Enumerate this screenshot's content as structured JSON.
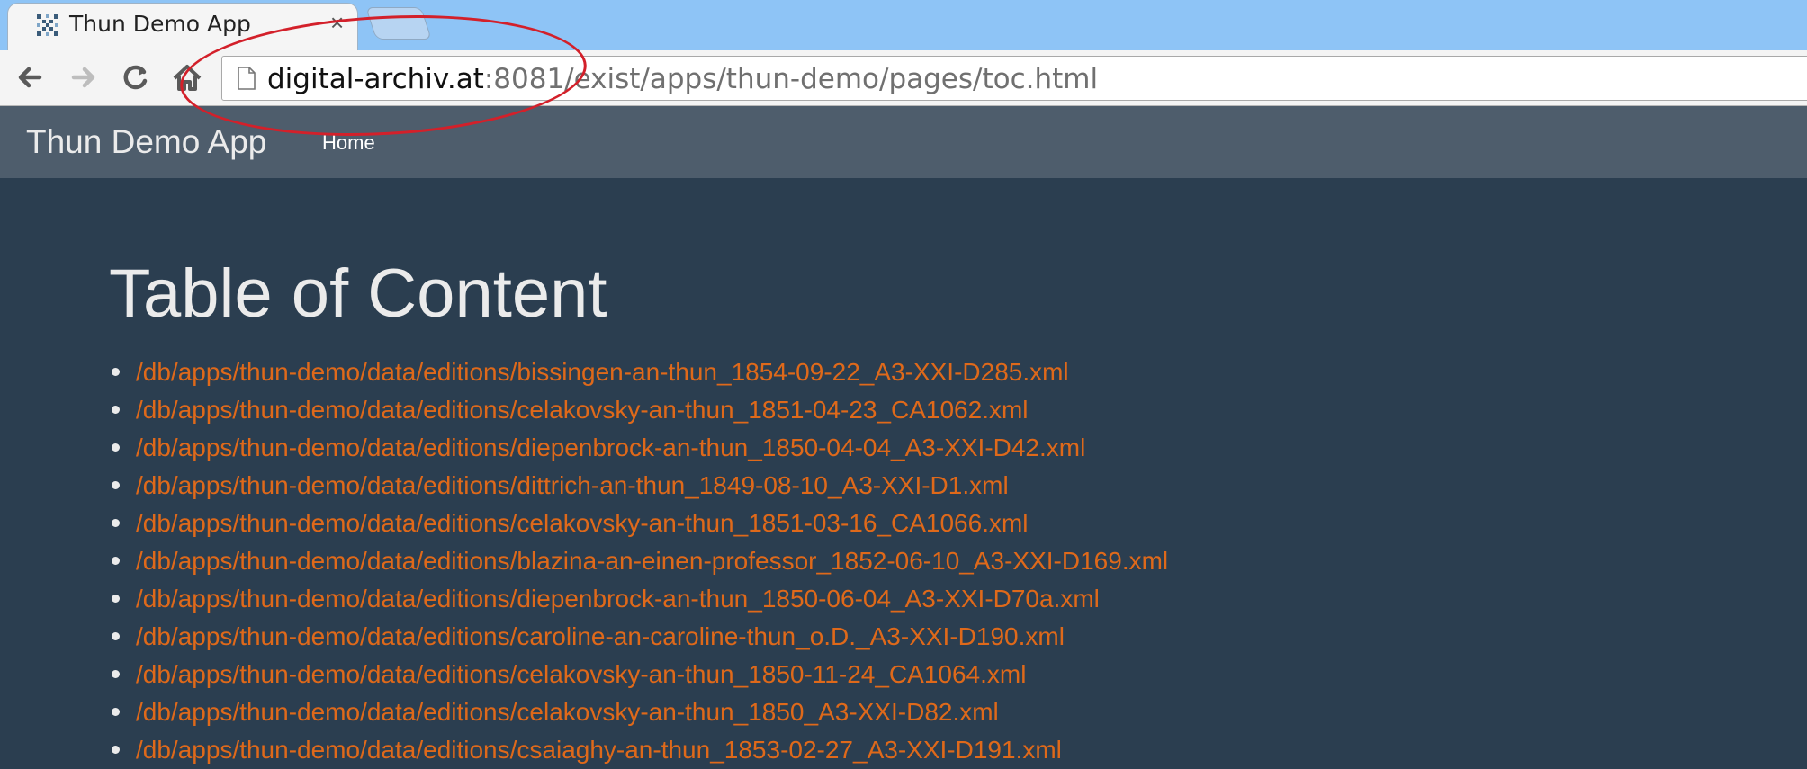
{
  "browser": {
    "tab": {
      "title": "Thun Demo App",
      "close_glyph": "×",
      "favicon": "app-favicon-icon"
    },
    "url": {
      "host": "digital-archiv.at",
      "rest": ":8081/exist/apps/thun-demo/pages/toc.html"
    },
    "icons": {
      "back": "back-arrow-icon",
      "forward": "forward-arrow-icon",
      "reload": "reload-icon",
      "home": "home-icon",
      "page": "page-icon"
    },
    "colors": {
      "tabstrip": "#8ec4f6",
      "annotation": "#d3202a"
    }
  },
  "app": {
    "brand": "Thun Demo App",
    "nav": {
      "home": "Home"
    },
    "colors": {
      "background": "#2b3e50",
      "navbar": "#4e5d6c",
      "link": "#df691a",
      "text": "#ebebeb"
    }
  },
  "content": {
    "heading": "Table of Content",
    "items": [
      "/db/apps/thun-demo/data/editions/bissingen-an-thun_1854-09-22_A3-XXI-D285.xml",
      "/db/apps/thun-demo/data/editions/celakovsky-an-thun_1851-04-23_CA1062.xml",
      "/db/apps/thun-demo/data/editions/diepenbrock-an-thun_1850-04-04_A3-XXI-D42.xml",
      "/db/apps/thun-demo/data/editions/dittrich-an-thun_1849-08-10_A3-XXI-D1.xml",
      "/db/apps/thun-demo/data/editions/celakovsky-an-thun_1851-03-16_CA1066.xml",
      "/db/apps/thun-demo/data/editions/blazina-an-einen-professor_1852-06-10_A3-XXI-D169.xml",
      "/db/apps/thun-demo/data/editions/diepenbrock-an-thun_1850-06-04_A3-XXI-D70a.xml",
      "/db/apps/thun-demo/data/editions/caroline-an-caroline-thun_o.D._A3-XXI-D190.xml",
      "/db/apps/thun-demo/data/editions/celakovsky-an-thun_1850-11-24_CA1064.xml",
      "/db/apps/thun-demo/data/editions/celakovsky-an-thun_1850_A3-XXI-D82.xml",
      "/db/apps/thun-demo/data/editions/csaiaghy-an-thun_1853-02-27_A3-XXI-D191.xml"
    ]
  }
}
